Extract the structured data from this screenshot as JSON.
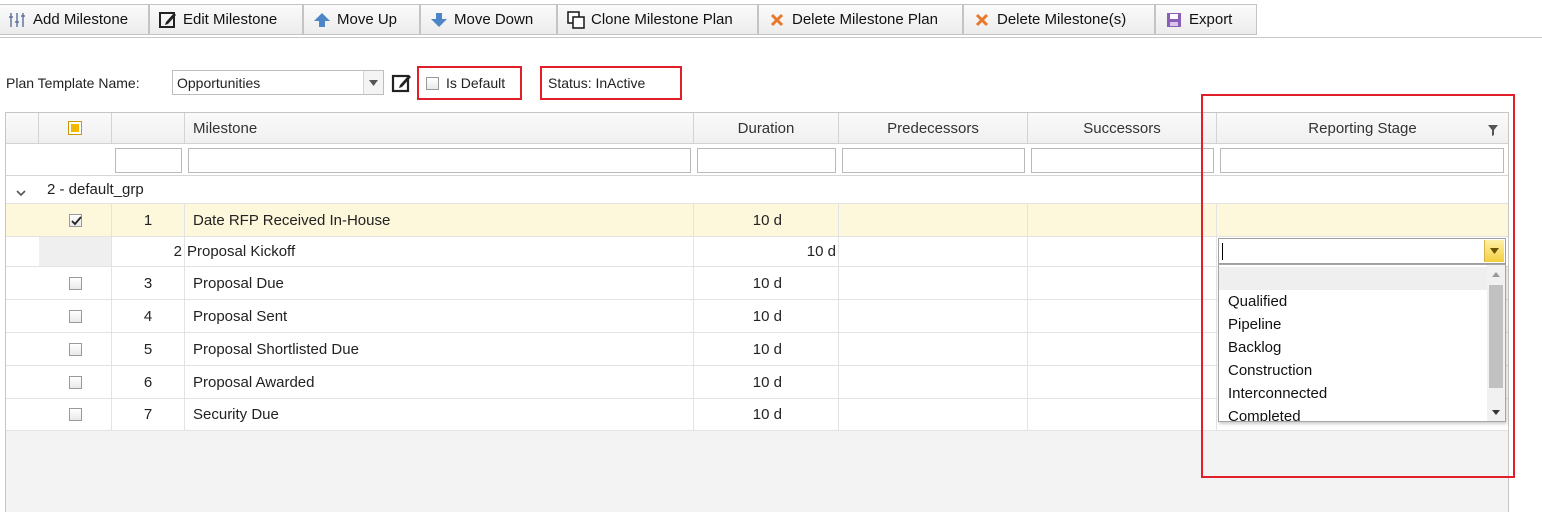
{
  "toolbar": {
    "buttons": [
      {
        "label": "Add Milestone",
        "icon": "add-milestone-icon"
      },
      {
        "label": "Edit Milestone",
        "icon": "edit-icon"
      },
      {
        "label": "Move Up",
        "icon": "arrow-up-icon"
      },
      {
        "label": "Move Down",
        "icon": "arrow-down-icon"
      },
      {
        "label": "Clone Milestone Plan",
        "icon": "clone-icon"
      },
      {
        "label": "Delete Milestone Plan",
        "icon": "delete-x-icon"
      },
      {
        "label": "Delete Milestone(s)",
        "icon": "delete-x-icon"
      },
      {
        "label": "Export",
        "icon": "export-icon"
      }
    ]
  },
  "plan": {
    "label": "Plan Template Name:",
    "selected": "Opportunities",
    "is_default_label": "Is Default",
    "is_default_checked": false,
    "status_text": "Status: InActive"
  },
  "grid": {
    "columns": {
      "milestone": "Milestone",
      "duration": "Duration",
      "predecessors": "Predecessors",
      "successors": "Successors",
      "reporting_stage": "Reporting Stage"
    },
    "group_label": "2 - default_grp",
    "rows": [
      {
        "num": "1",
        "name": "Date RFP Received In-House",
        "duration": "10 d",
        "checked": true
      },
      {
        "num": "2",
        "name": "Proposal Kickoff",
        "duration": "10 d",
        "checked": false
      },
      {
        "num": "3",
        "name": "Proposal Due",
        "duration": "10 d",
        "checked": false
      },
      {
        "num": "4",
        "name": "Proposal Sent",
        "duration": "10 d",
        "checked": false
      },
      {
        "num": "5",
        "name": "Proposal Shortlisted Due",
        "duration": "10 d",
        "checked": false
      },
      {
        "num": "6",
        "name": "Proposal Awarded",
        "duration": "10 d",
        "checked": false
      },
      {
        "num": "7",
        "name": "Security Due",
        "duration": "10 d",
        "checked": false
      }
    ]
  },
  "reporting_dropdown": {
    "value": "",
    "options": [
      "",
      "Qualified",
      "Pipeline",
      "Backlog",
      "Construction",
      "Interconnected",
      "Completed"
    ]
  },
  "colors": {
    "highlight_red": "#e11f28",
    "selected_row": "#fdf7dc",
    "header_checkbox": "#f5b800"
  }
}
